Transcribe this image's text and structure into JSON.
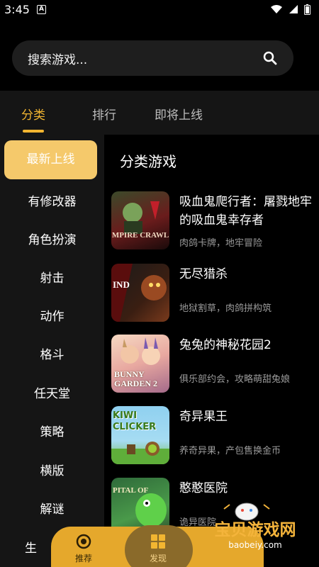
{
  "status_bar": {
    "time": "3:45",
    "notif_letter": "A"
  },
  "search": {
    "placeholder": "搜索游戏..."
  },
  "tabs": [
    {
      "label": "分类",
      "active": true
    },
    {
      "label": "排行",
      "active": false
    },
    {
      "label": "即将上线",
      "active": false
    }
  ],
  "sidebar": {
    "items": [
      {
        "label": "最新上线",
        "active": true
      },
      {
        "label": "有修改器"
      },
      {
        "label": "角色扮演"
      },
      {
        "label": "射击"
      },
      {
        "label": "动作"
      },
      {
        "label": "格斗"
      },
      {
        "label": "任天堂"
      },
      {
        "label": "策略"
      },
      {
        "label": "横版"
      },
      {
        "label": "解谜"
      },
      {
        "label": "生"
      }
    ]
  },
  "main": {
    "title": "分类游戏",
    "games": [
      {
        "name": "吸血鬼爬行者：屠戮地牢的吸血鬼幸存者",
        "desc": "肉鸽卡牌，地牢冒险",
        "thumb_text": "MPIRE CRAWL"
      },
      {
        "name": "无尽猎杀",
        "desc": "地狱割草，肉鸽拼构筑",
        "thumb_text": "IND"
      },
      {
        "name": "兔兔的神秘花园2",
        "desc": "俱乐部约会，攻略萌甜兔娘",
        "thumb_text": "BUNNY GARDEN 2"
      },
      {
        "name": "奇异果王",
        "desc": "养奇异果，产包售换金币",
        "thumb_text": "KIWI CLICKER"
      },
      {
        "name": "憨憨医院",
        "desc": "诡异医院",
        "thumb_text": "PITAL OF"
      }
    ]
  },
  "bottom_nav": {
    "items": [
      {
        "label": "推荐",
        "icon": "target-icon"
      },
      {
        "label": "发现",
        "icon": "grid-icon"
      }
    ]
  },
  "watermark": {
    "text": "宝贝游戏网",
    "url": "baobeiy.com"
  },
  "colors": {
    "accent": "#f2b531",
    "sidebar_active": "#f5c96b",
    "nav_bg": "#e5a82c"
  }
}
